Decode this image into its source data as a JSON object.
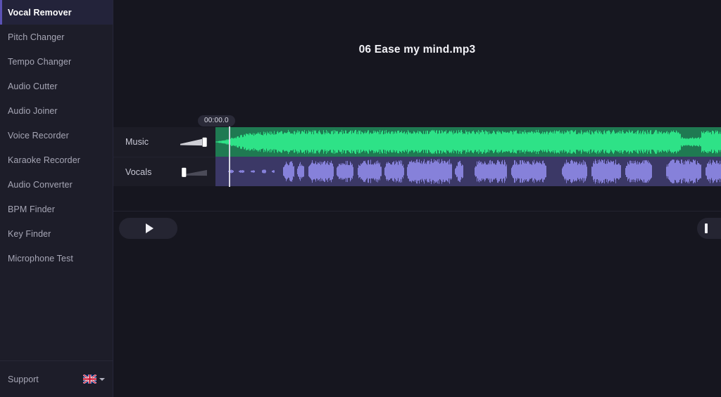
{
  "app": {
    "background_color": "#14141d",
    "accent_color": "#5b52b5"
  },
  "sidebar": {
    "items": [
      {
        "label": "Vocal Remover",
        "active": true
      },
      {
        "label": "Pitch Changer",
        "active": false
      },
      {
        "label": "Tempo Changer",
        "active": false
      },
      {
        "label": "Audio Cutter",
        "active": false
      },
      {
        "label": "Audio Joiner",
        "active": false
      },
      {
        "label": "Voice Recorder",
        "active": false
      },
      {
        "label": "Karaoke Recorder",
        "active": false
      },
      {
        "label": "Audio Converter",
        "active": false
      },
      {
        "label": "BPM Finder",
        "active": false
      },
      {
        "label": "Key Finder",
        "active": false
      },
      {
        "label": "Microphone Test",
        "active": false
      }
    ],
    "footer": {
      "support_label": "Support",
      "language_icon": "uk-flag-icon",
      "language_caret_icon": "chevron-down-icon"
    }
  },
  "main": {
    "file_title": "06 Ease my mind.mp3",
    "timeline": {
      "timecode": "00:00.0",
      "playhead_icon": "playhead-line",
      "tracks": [
        {
          "name": "Music",
          "color": "#2fe88a",
          "background_color": "#1f7a52",
          "volume": 100,
          "volume_slider_icon": "volume-wedge-slider"
        },
        {
          "name": "Vocals",
          "color": "#8b85e0",
          "background_color": "#3b3866",
          "volume": 0,
          "volume_slider_icon": "volume-wedge-slider"
        }
      ]
    },
    "controls": {
      "play_label": "",
      "play_icon": "play-icon",
      "right_action_icon": "pause-bar-icon"
    }
  }
}
